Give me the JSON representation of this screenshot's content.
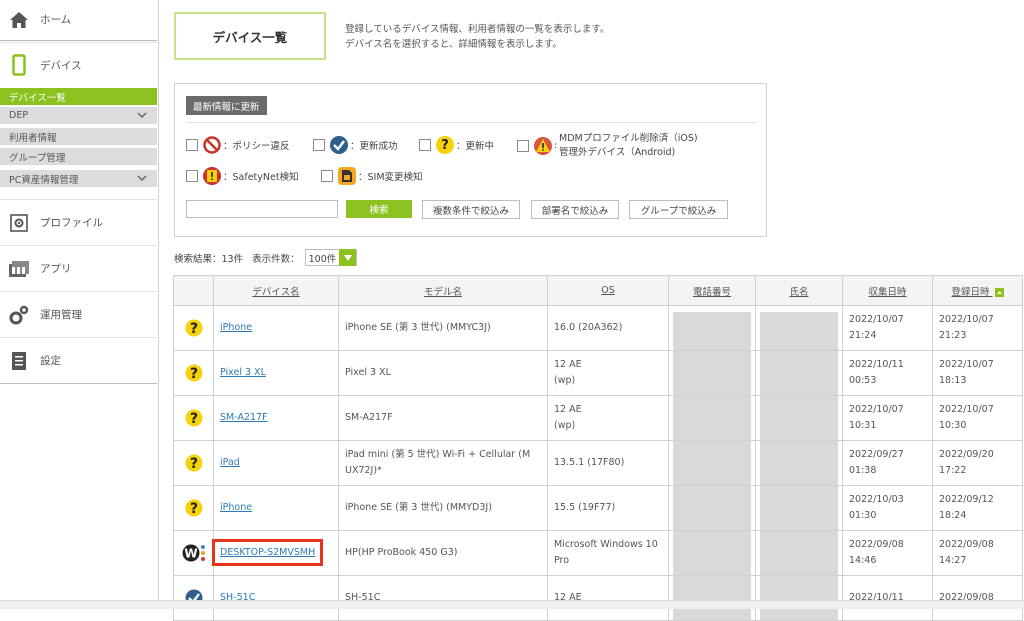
{
  "sidebar": {
    "home_label": "ホーム",
    "device_label": "デバイス",
    "sub_items": [
      {
        "label": "デバイス一覧",
        "active": true
      },
      {
        "label": "DEP",
        "has_chevron": true
      },
      {
        "label": "利用者情報"
      },
      {
        "label": "グループ管理"
      },
      {
        "label": "PC資産情報管理",
        "has_chevron": true
      }
    ],
    "profile_label": "プロファイル",
    "app_label": "アプリ",
    "ops_label": "運用管理",
    "settings_label": "設定"
  },
  "header": {
    "title": "デバイス一覧",
    "desc_line1": "登録しているデバイス情報、利用者情報の一覧を表示します。",
    "desc_line2": "デバイス名を選択すると、詳細情報を表示します。"
  },
  "filters": {
    "refresh_label": "最新情報に更新",
    "policy_violation": "：ポリシー違反",
    "update_success": "：更新成功",
    "updating": "：更新中",
    "mdm_removed_line1": "MDMプロファイル削除済（iOS)",
    "mdm_removed_line2": "管理外デバイス（Android)",
    "safetynet": "：SafetyNet検知",
    "sim_change": "：SIM変更検知",
    "search_value": "",
    "search_button": "検索",
    "multi_condition": "複数条件で絞込み",
    "by_department": "部署名で絞込み",
    "by_group": "グループで絞込み"
  },
  "results": {
    "count_text": "検索結果：13件",
    "per_page_label": "表示件数：",
    "per_page_value": "100件"
  },
  "table": {
    "headers": [
      "デバイス名",
      "モデル名",
      "OS",
      "電話番号",
      "氏名",
      "収集日時",
      "登録日時"
    ],
    "rows": [
      {
        "status": "updating",
        "name": "iPhone",
        "model": "iPhone SE (第 3 世代) (MMYC3J)",
        "os": "16.0 (20A362)",
        "collected": "2022/10/07\n21:24",
        "registered": "2022/10/07\n21:23"
      },
      {
        "status": "updating",
        "name": "Pixel 3 XL",
        "model": "Pixel 3 XL",
        "os": "12 AE\n(wp)",
        "collected": "2022/10/11\n00:53",
        "registered": "2022/10/07\n18:13"
      },
      {
        "status": "updating",
        "name": "SM-A217F",
        "model": "SM-A217F",
        "os": "12 AE\n(wp)",
        "collected": "2022/10/07\n10:31",
        "registered": "2022/10/07\n10:30"
      },
      {
        "status": "updating",
        "name": "iPad",
        "model": "iPad mini (第 5 世代) Wi-Fi + Cellular (M\nUX72J)*",
        "os": "13.5.1 (17F80)",
        "collected": "2022/09/27\n01:38",
        "registered": "2022/09/20\n17:22"
      },
      {
        "status": "updating",
        "name": "iPhone",
        "model": "iPhone SE (第 3 世代) (MMYD3J)",
        "os": "15.5 (19F77)",
        "collected": "2022/10/03\n01:30",
        "registered": "2022/09/12\n18:24"
      },
      {
        "status": "windows",
        "name": "DESKTOP-S2MVSMH",
        "model": "HP(HP ProBook 450 G3)",
        "os": "Microsoft Windows 10\nPro",
        "collected": "2022/09/08\n14:46",
        "registered": "2022/09/08\n14:27",
        "highlighted": true
      },
      {
        "status": "success",
        "name": "SH-51C",
        "model": "SH-51C",
        "os": "12 AE",
        "collected": "2022/10/11",
        "registered": "2022/09/08"
      }
    ]
  },
  "colors": {
    "accent": "#8cc21f",
    "link": "#2e7ab6",
    "highlight": "#e8321f"
  }
}
